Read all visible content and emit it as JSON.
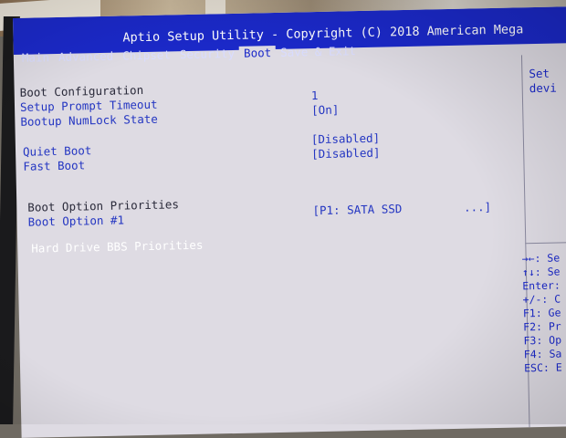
{
  "title": "Aptio Setup Utility - Copyright (C) 2018 American Mega",
  "tabs": [
    "Main",
    "Advanced",
    "Chipset",
    "Security",
    "Boot",
    "Save & Exit"
  ],
  "active_tab": "Boot",
  "section_title": "Boot Configuration",
  "settings": {
    "setup_prompt_timeout": {
      "label": "Setup Prompt Timeout",
      "value": "1"
    },
    "bootup_numlock_state": {
      "label": "Bootup NumLock State",
      "value": "[On]"
    },
    "quiet_boot": {
      "label": "Quiet Boot",
      "value": "[Disabled]"
    },
    "fast_boot": {
      "label": "Fast Boot",
      "value": "[Disabled]"
    }
  },
  "boot_priorities": {
    "heading": "Boot Option Priorities",
    "option1_label": "Boot Option #1",
    "option1_value": "[P1: SATA SSD         ...]"
  },
  "hard_drive_bbs": "Hard Drive BBS Priorities",
  "help_text": [
    "Set",
    "devi"
  ],
  "key_help": [
    "→←: Se",
    "↑↓: Se",
    "Enter:",
    "+/-: C",
    "F1: Ge",
    "F2: Pr",
    "F3: Op",
    "F4: Sa",
    "ESC: E"
  ],
  "colors": {
    "title_bar": "#1b29c9",
    "background": "#dedbe3",
    "item_text": "#2436c2",
    "selected_item": "#ffffff"
  }
}
